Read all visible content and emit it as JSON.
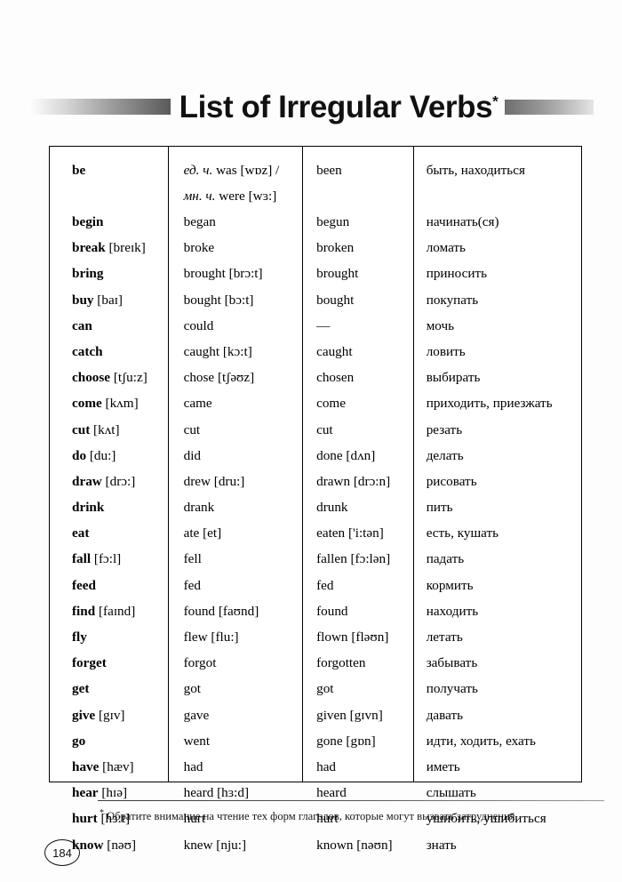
{
  "header": {
    "title": "List of Irregular Verbs",
    "title_asterisk": "*",
    "rule_left": "decorative-gradient-bar",
    "rule_right": "decorative-gradient-bar"
  },
  "table": {
    "columns": [
      "infinitive",
      "past-simple",
      "past-participle",
      "translation"
    ],
    "rows": [
      {
        "tall": true,
        "c1": "be",
        "c2_lines": [
          {
            "ital": "ед. ч.",
            "rest": " was [wɒz] /"
          },
          {
            "ital": "мн. ч.",
            "rest": " were [wɜ:]"
          }
        ],
        "c3": "been",
        "c4": "быть, находиться"
      },
      {
        "c1": "begin",
        "c2": "began",
        "c3": "begun",
        "c4": "начинать(ся)"
      },
      {
        "c1": "break",
        "c1_tr": "[breɪk]",
        "c2": "broke",
        "c3": "broken",
        "c4": "ломать"
      },
      {
        "c1": "bring",
        "c2": "brought",
        "c2_tr": "[brɔ:t]",
        "c3": "brought",
        "c4": "приносить"
      },
      {
        "c1": "buy",
        "c1_tr": "[baɪ]",
        "c2": "bought",
        "c2_tr": "[bɔ:t]",
        "c3": "bought",
        "c4": "покупать"
      },
      {
        "c1": "can",
        "c2": "could",
        "c3": "—",
        "c4": "мочь"
      },
      {
        "c1": "catch",
        "c2": "caught",
        "c2_tr": "[kɔ:t]",
        "c3": "caught",
        "c4": "ловить"
      },
      {
        "c1": "choose",
        "c1_tr": "[tʃu:z]",
        "c2": "chose",
        "c2_tr": "[tʃəʊz]",
        "c3": "chosen",
        "c4": "выбирать"
      },
      {
        "c1": "come",
        "c1_tr": "[kʌm]",
        "c2": "came",
        "c3": "come",
        "c4": "приходить, приезжать"
      },
      {
        "c1": "cut",
        "c1_tr": "[kʌt]",
        "c2": "cut",
        "c3": "cut",
        "c4": "резать"
      },
      {
        "c1": "do",
        "c1_tr": "[du:]",
        "c2": "did",
        "c3": "done",
        "c3_tr": "[dʌn]",
        "c4": "делать"
      },
      {
        "c1": "draw",
        "c1_tr": "[drɔ:]",
        "c2": "drew",
        "c2_tr": "[dru:]",
        "c3": "drawn",
        "c3_tr": "[drɔ:n]",
        "c4": "рисовать"
      },
      {
        "c1": "drink",
        "c2": "drank",
        "c3": "drunk",
        "c4": "пить"
      },
      {
        "c1": "eat",
        "c2": "ate",
        "c2_tr": "[et]",
        "c3": "eaten",
        "c3_tr": "['i:tən]",
        "c4": "есть, кушать"
      },
      {
        "c1": "fall",
        "c1_tr": "[fɔ:l]",
        "c2": "fell",
        "c3": "fallen",
        "c3_tr": "[fɔ:lən]",
        "c4": "падать"
      },
      {
        "c1": "feed",
        "c2": "fed",
        "c3": "fed",
        "c4": "кормить"
      },
      {
        "c1": "find",
        "c1_tr": "[faɪnd]",
        "c2": "found",
        "c2_tr": "[faʊnd]",
        "c3": "found",
        "c4": "находить"
      },
      {
        "c1": "fly",
        "c2": "flew",
        "c2_tr": "[flu:]",
        "c3": "flown",
        "c3_tr": "[fləʊn]",
        "c4": "летать"
      },
      {
        "c1": "forget",
        "c2": "forgot",
        "c3": "forgotten",
        "c4": "забывать"
      },
      {
        "c1": "get",
        "c2": "got",
        "c3": "got",
        "c4": "получать"
      },
      {
        "c1": "give",
        "c1_tr": "[gɪv]",
        "c2": "gave",
        "c3": "given",
        "c3_tr": "[gɪvn]",
        "c4": "давать"
      },
      {
        "c1": "go",
        "c2": "went",
        "c3": "gone",
        "c3_tr": "[gɒn]",
        "c4": "идти, ходить, ехать"
      },
      {
        "c1": "have",
        "c1_tr": "[hæv]",
        "c2": "had",
        "c3": "had",
        "c4": "иметь"
      },
      {
        "c1": "hear",
        "c1_tr": "[hɪə]",
        "c2": "heard",
        "c2_tr": "[hɜ:d]",
        "c3": "heard",
        "c4": "слышать"
      },
      {
        "c1": "hurt",
        "c1_tr": "[hɜ:t]",
        "c2": "hurt",
        "c3": "hurt",
        "c4": "ушибить, ушибиться"
      },
      {
        "c1": "know",
        "c1_tr": "[nəʊ]",
        "c2": "knew",
        "c2_tr": "[nju:]",
        "c3": "known",
        "c3_tr": "[nəʊn]",
        "c4": "знать"
      }
    ]
  },
  "footnote": {
    "marker": "*",
    "text": "Обратите внимание на чтение тех форм глаголов, которые могут вызвать затруднения."
  },
  "page_number": "184"
}
